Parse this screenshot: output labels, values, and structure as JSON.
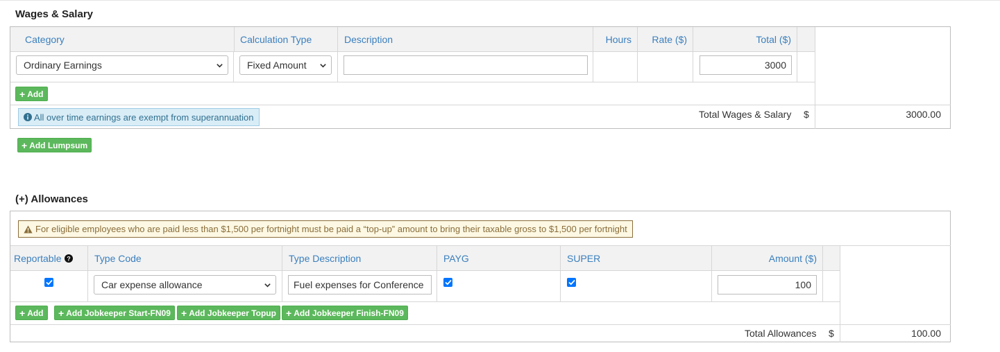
{
  "wages": {
    "title": "Wages & Salary",
    "headers": {
      "category": "Category",
      "calc_type": "Calculation Type",
      "description": "Description",
      "hours": "Hours",
      "rate": "Rate ($)",
      "total": "Total ($)"
    },
    "row": {
      "category": "Ordinary Earnings",
      "calc_type": "Fixed Amount",
      "description": "",
      "total": "3000"
    },
    "add_label": "Add",
    "info_text": "All over time earnings are exempt from superannuation",
    "total_label": "Total Wages & Salary",
    "currency": "$",
    "total_value": "3000.00",
    "add_lumpsum_label": "Add Lumpsum"
  },
  "allowances": {
    "title": "(+) Allowances",
    "warning_text": "For eligible employees who are paid less than $1,500 per fortnight must be paid a “top-up” amount to bring their taxable gross to $1,500 per fortnight",
    "headers": {
      "reportable": "Reportable",
      "type_code": "Type Code",
      "type_description": "Type Description",
      "payg": "PAYG",
      "super": "SUPER",
      "amount": "Amount ($)"
    },
    "row": {
      "reportable": true,
      "type_code": "Car expense allowance",
      "type_description": "Fuel expenses for Conference",
      "payg": true,
      "super": true,
      "amount": "100"
    },
    "buttons": {
      "add": "Add",
      "jk_start": "Add Jobkeeper Start-FN09",
      "jk_topup": "Add Jobkeeper Topup",
      "jk_finish": "Add Jobkeeper Finish-FN09"
    },
    "total_label": "Total Allowances",
    "currency": "$",
    "total_value": "100.00"
  },
  "colors": {
    "header_text": "#3a7fbd",
    "button_green": "#5cb85c",
    "info_bg": "#d9edf7",
    "warning_bg": "#fcf8e3",
    "checkbox_blue": "#0075ff"
  },
  "icons": {
    "info": "info-circle-icon",
    "warning": "warning-triangle-icon",
    "question": "question-circle-icon",
    "plus": "plus-icon",
    "chevron": "chevron-down-icon",
    "check": "check-icon"
  }
}
